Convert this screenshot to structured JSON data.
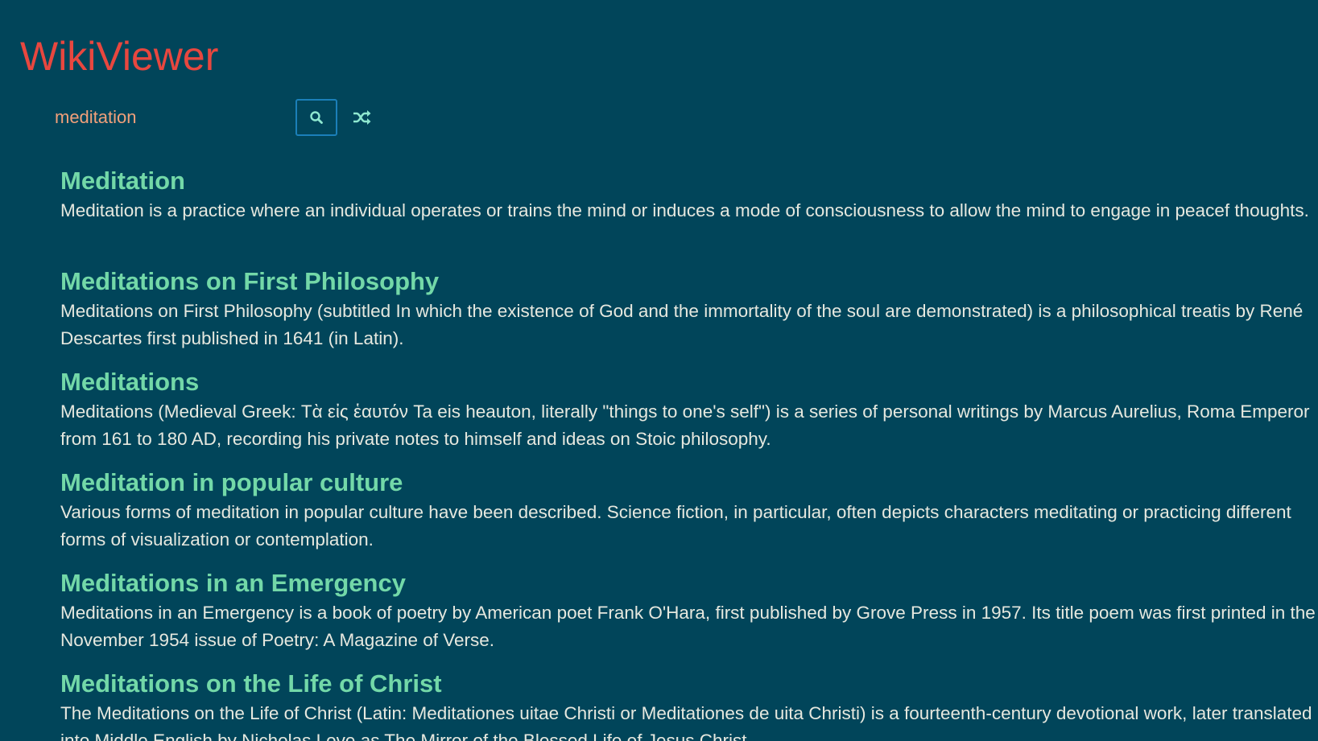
{
  "app": {
    "title": "WikiViewer"
  },
  "search": {
    "value": "meditation",
    "placeholder": "",
    "search_icon": "search-icon",
    "random_icon": "shuffle-icon"
  },
  "colors": {
    "background": "#01455a",
    "title": "#e8473f",
    "input_text": "#f2a07a",
    "result_title": "#73d8a8",
    "snippet_text": "#e6e8df",
    "button_border": "#1b7fb9"
  },
  "results": [
    {
      "title": "Meditation",
      "snippet": "Meditation is a practice where an individual operates or trains the mind or induces a mode of consciousness to allow the mind to engage in peacef thoughts."
    },
    {
      "title": "Meditations on First Philosophy",
      "snippet": "Meditations on First Philosophy (subtitled In which the existence of God and the immortality of the soul are demonstrated) is a philosophical treatis by René Descartes first published in 1641 (in Latin)."
    },
    {
      "title": "Meditations",
      "snippet": "Meditations (Medieval Greek: Τὰ εἰς ἑαυτόν Ta eis heauton, literally \"things to one's self\") is a series of personal writings by Marcus Aurelius, Roma Emperor from 161 to 180 AD, recording his private notes to himself and ideas on Stoic philosophy."
    },
    {
      "title": "Meditation in popular culture",
      "snippet": "Various forms of meditation in popular culture have been described. Science fiction, in particular, often depicts characters meditating or practicing different forms of visualization or contemplation."
    },
    {
      "title": "Meditations in an Emergency",
      "snippet": "Meditations in an Emergency is a book of poetry by American poet Frank O'Hara, first published by Grove Press in 1957. Its title poem was first printed in the November 1954 issue of Poetry: A Magazine of Verse."
    },
    {
      "title": "Meditations on the Life of Christ",
      "snippet": "The Meditations on the Life of Christ (Latin: Meditationes uitae Christi or Meditationes de uita Christi) is a fourteenth-century devotional work, later translated into Middle English by Nicholas Love as The Mirror of the Blessed Life of Jesus Christ."
    }
  ]
}
